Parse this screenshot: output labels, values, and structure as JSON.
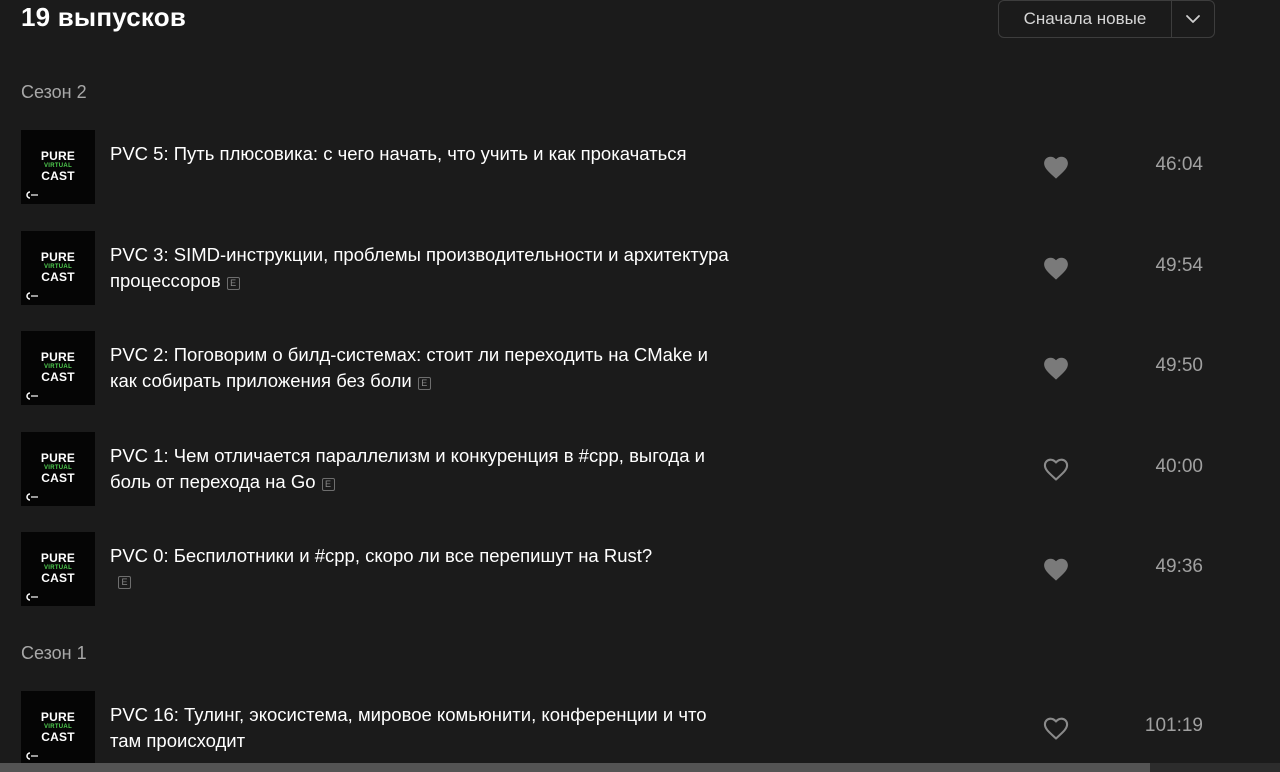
{
  "header": {
    "count_title": "19 выпусков",
    "sort_label": "Сначала новые"
  },
  "seasons": [
    {
      "label": "Сезон 2"
    },
    {
      "label": "Сезон 1"
    }
  ],
  "cover": {
    "line1": "PURE",
    "line2": "VIRTUAL",
    "line3": "CAST",
    "accent": "#4fcf4f"
  },
  "explicit_mark": "E",
  "episodes": [
    {
      "title": "PVC 5: Путь плюсовика: с чего начать, что учить и как прокачаться",
      "duration": "46:04",
      "liked": true,
      "explicit": false
    },
    {
      "title": "PVC 3: SIMD-инструкции, проблемы производительности и архитектура процессоров",
      "duration": "49:54",
      "liked": true,
      "explicit": true
    },
    {
      "title": "PVC 2: Поговорим о билд-системах: стоит ли переходить на CMake и как собирать приложения без боли",
      "duration": "49:50",
      "liked": true,
      "explicit": true
    },
    {
      "title": "PVC 1: Чем отличается параллелизм и конкуренция в #cpp, выгода и боль от перехода на Go",
      "duration": "40:00",
      "liked": false,
      "explicit": true
    },
    {
      "title": "PVC 0: Беспилотники и #cpp, скоро ли все перепишут на Rust?",
      "duration": "49:36",
      "liked": true,
      "explicit": true
    },
    {
      "title": "PVC 16: Тулинг, экосистема, мировое комьюнити, конференции и что там происходит",
      "duration": "101:19",
      "liked": false,
      "explicit": false
    }
  ],
  "colors": {
    "background": "#1b1b1b",
    "text": "#ffffff",
    "muted": "#a0a0a0",
    "like_filled": "#7a7a7a"
  },
  "icons": {
    "sort_arrow": "chevron-down-icon",
    "like_filled": "heart-filled-icon",
    "like_outline": "heart-outline-icon",
    "explicit": "explicit-icon"
  }
}
